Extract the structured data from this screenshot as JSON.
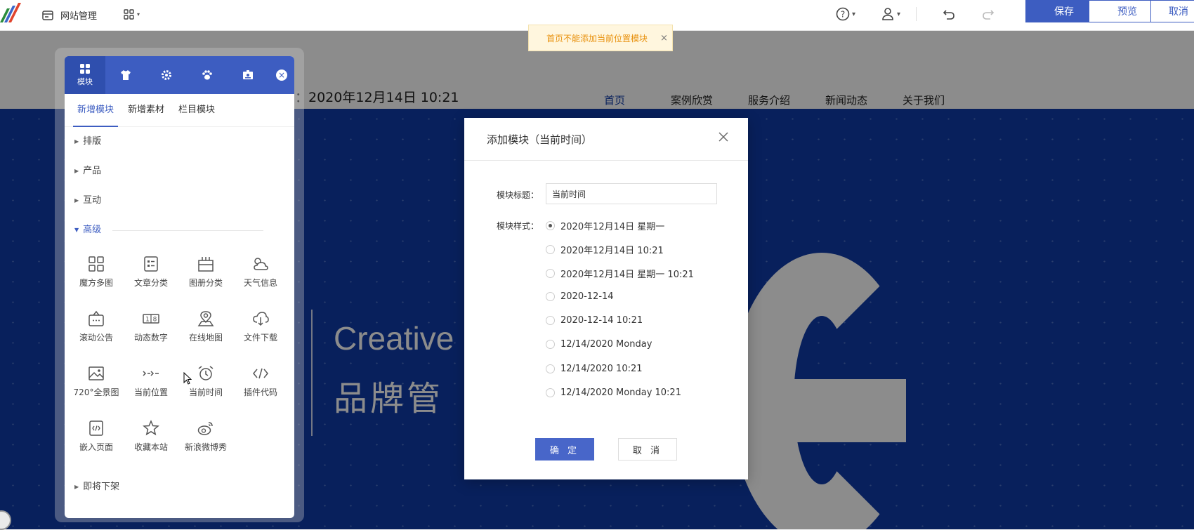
{
  "toolbar": {
    "site_manage": "网站管理",
    "save": "保存",
    "preview": "预览",
    "cancel": "取消"
  },
  "toast": {
    "text": "首页不能添加当前位置模块",
    "close": "×"
  },
  "site": {
    "date_text": "：2020年12月14日 10:21",
    "nav": [
      "首页",
      "案例欣赏",
      "服务介绍",
      "新闻动态",
      "关于我们"
    ],
    "banner_en": "Creative I",
    "banner_cn": "品牌管"
  },
  "panel": {
    "tabs": [
      {
        "label": "模块",
        "icon": "modules-icon"
      },
      {
        "label": "",
        "icon": "shirt-icon"
      },
      {
        "label": "",
        "icon": "gear-icon"
      },
      {
        "label": "",
        "icon": "paw-icon"
      },
      {
        "label": "",
        "icon": "badge-icon"
      }
    ],
    "close": "×",
    "sub_tabs": [
      "新增模块",
      "新增素材",
      "栏目模块"
    ],
    "categories": [
      "排版",
      "产品",
      "互动",
      "高级",
      "即将下架"
    ],
    "modules": [
      "魔方多图",
      "文章分类",
      "图册分类",
      "天气信息",
      "滚动公告",
      "动态数字",
      "在线地图",
      "文件下载",
      "720°全景图",
      "当前位置",
      "当前时间",
      "插件代码",
      "嵌入页面",
      "收藏本站",
      "新浪微博秀"
    ]
  },
  "dialog": {
    "title": "添加模块（当前时间）",
    "title_label": "模块标题：",
    "title_value": "当前时间",
    "style_label": "模块样式：",
    "options": [
      "2020年12月14日 星期一",
      "2020年12月14日 10:21",
      "2020年12月14日 星期一 10:21",
      "2020-12-14",
      "2020-12-14 10:21",
      "12/14/2020 Monday",
      "12/14/2020 10:21",
      "12/14/2020 Monday 10:21"
    ],
    "selected_index": 0,
    "ok": "确 定",
    "cancel": "取 消"
  },
  "colors": {
    "accent": "#3d5dc1",
    "banner": "#0f3ba8",
    "toast_text": "#e8900b"
  }
}
